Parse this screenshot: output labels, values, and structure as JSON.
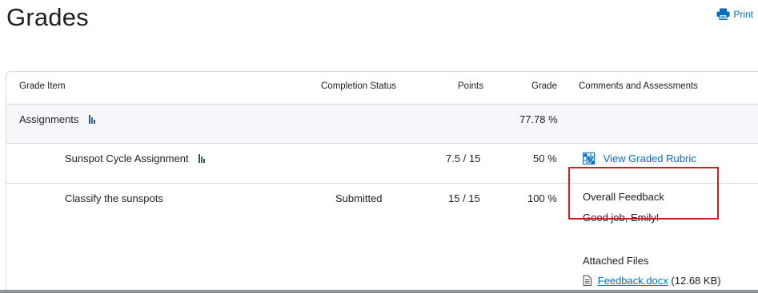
{
  "page": {
    "title": "Grades"
  },
  "toolbar": {
    "print_label": "Print"
  },
  "table": {
    "headers": {
      "grade_item": "Grade Item",
      "completion_status": "Completion Status",
      "points": "Points",
      "grade": "Grade",
      "comments": "Comments and Assessments"
    },
    "group": {
      "name": "Assignments",
      "grade": "77.78 %"
    },
    "items": [
      {
        "name": "Sunspot Cycle Assignment",
        "status": "",
        "points": "7.5 / 15",
        "grade": "50 %",
        "rubric_link": "View Graded Rubric"
      },
      {
        "name": "Classify the sunspots",
        "status": "Submitted",
        "points": "15 / 15",
        "grade": "100 %",
        "feedback_heading": "Overall Feedback",
        "feedback_text": "Good job, Emily!",
        "attached_heading": "Attached Files",
        "file_name": "Feedback.docx",
        "file_size": "(12.68 KB)"
      }
    ]
  },
  "colors": {
    "link": "#006fbf",
    "group_row_bg": "#f5f7fa",
    "highlight_border": "#cc1f25"
  },
  "icons": [
    "printer-icon",
    "stats-icon",
    "rubric-icon",
    "document-icon"
  ]
}
